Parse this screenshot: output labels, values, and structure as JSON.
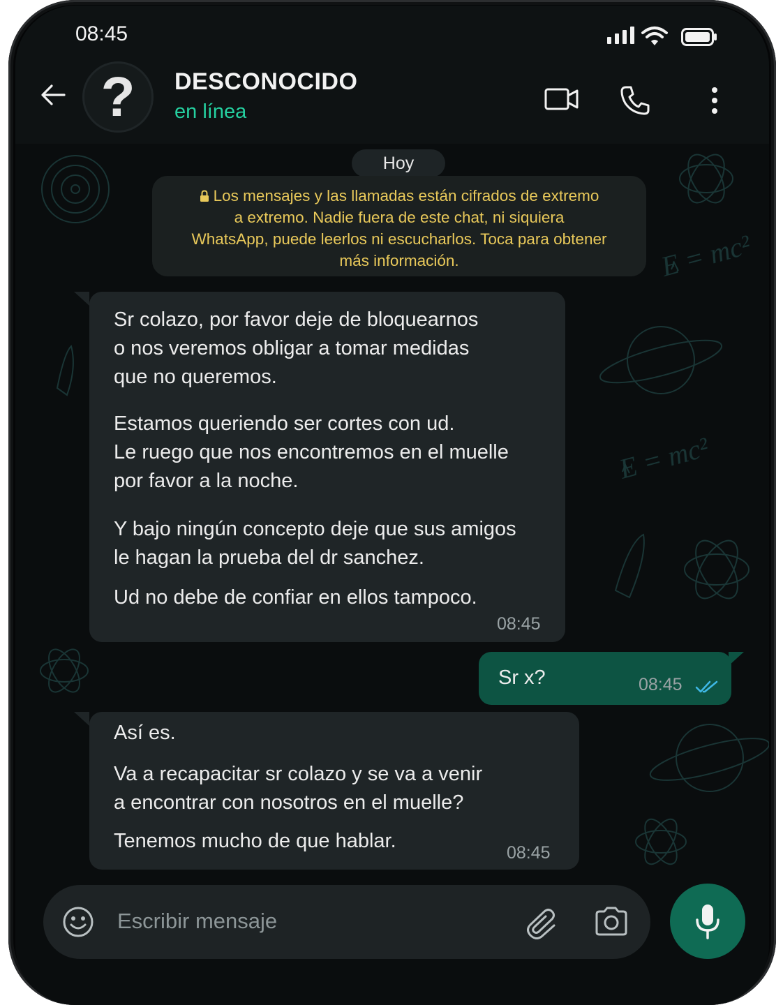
{
  "status_bar": {
    "time": "08:45"
  },
  "header": {
    "avatar_glyph": "?",
    "contact_name": "DESCONOCIDO",
    "status": "en línea",
    "icons": [
      "back-arrow-icon",
      "video-call-icon",
      "phone-icon",
      "more-vert-icon"
    ]
  },
  "chat": {
    "date_pill": "Hoy",
    "encryption_notice": [
      "Los mensajes y las llamadas están cifrados de extremo",
      "a extremo. Nadie fuera de este chat, ni siquiera",
      "WhatsApp, puede leerlos ni escucharlos. Toca para obtener",
      "más información."
    ],
    "messages": [
      {
        "direction": "incoming",
        "lines": [
          "Sr colazo, por favor deje de bloquearnos",
          "o nos veremos obligar a tomar medidas",
          "que no queremos.",
          "Estamos queriendo ser cortes con ud.",
          "Le ruego que nos encontremos en el muelle",
          "por favor a la noche.",
          "Y bajo ningún concepto deje que sus amigos",
          "le hagan la prueba del dr sanchez.",
          "Ud no debe de confiar en ellos tampoco."
        ],
        "time": "08:45"
      },
      {
        "direction": "outgoing",
        "lines": [
          "Sr x?"
        ],
        "time": "08:45",
        "read": true
      },
      {
        "direction": "incoming",
        "lines": [
          "Así es.",
          "Va a recapacitar sr colazo y se va a venir",
          "a encontrar con nosotros en el muelle?",
          "Tenemos mucho de que hablar."
        ],
        "time": "08:45"
      }
    ]
  },
  "composer": {
    "placeholder": "Escribir mensaje",
    "icons": [
      "emoji-icon",
      "attach-icon",
      "camera-icon",
      "mic-icon"
    ]
  },
  "colors": {
    "accent": "#25d0a0",
    "outgoing_bubble": "#0d5443",
    "incoming_bubble": "#1f2527",
    "notice_text": "#e9c95a",
    "mic_button": "#0f6b54"
  }
}
